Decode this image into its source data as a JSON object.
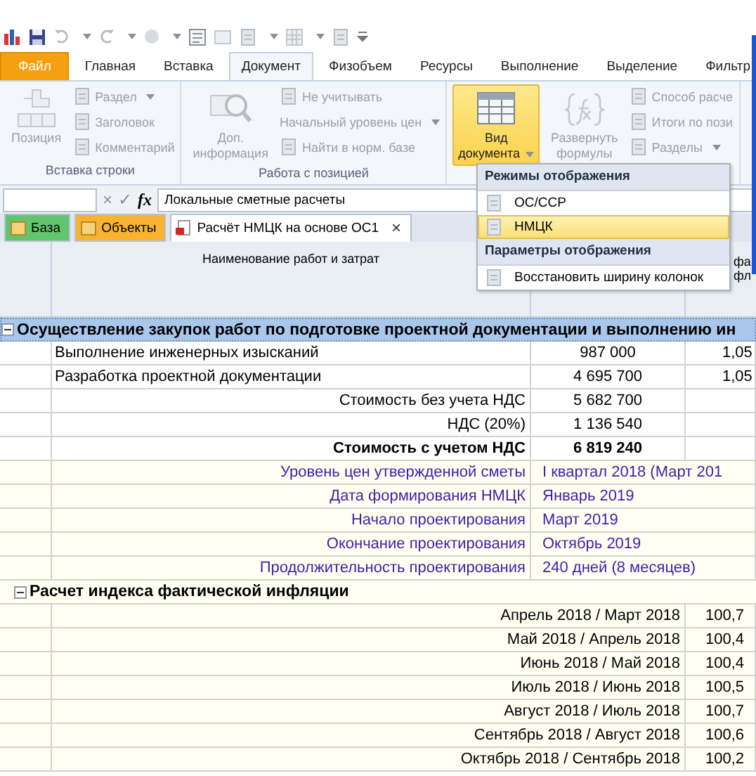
{
  "ribbon_tabs": [
    {
      "label": "Файл",
      "kind": "file",
      "selected": false
    },
    {
      "label": "Главная",
      "kind": "tab",
      "selected": false
    },
    {
      "label": "Вставка",
      "kind": "tab",
      "selected": false
    },
    {
      "label": "Документ",
      "kind": "tab",
      "selected": true
    },
    {
      "label": "Физобъем",
      "kind": "tab",
      "selected": false
    },
    {
      "label": "Ресурсы",
      "kind": "tab",
      "selected": false
    },
    {
      "label": "Выполнение",
      "kind": "tab",
      "selected": false
    },
    {
      "label": "Выделение",
      "kind": "tab",
      "selected": false
    },
    {
      "label": "Фильтр",
      "kind": "tab",
      "selected": false
    }
  ],
  "ribbon_groups": [
    {
      "label": "Вставка строки",
      "large": [
        {
          "lines": [
            "Позиция"
          ],
          "kind": "plus",
          "dropdown": false,
          "pressed": false,
          "disabled": true
        }
      ],
      "small": [
        {
          "label": "Раздел",
          "kind": "icon",
          "dropdown": true,
          "disabled": true
        },
        {
          "label": "Заголовок",
          "kind": "icon",
          "dropdown": false,
          "disabled": true
        },
        {
          "label": "Комментарий",
          "kind": "icon",
          "dropdown": false,
          "disabled": true
        }
      ]
    },
    {
      "label": "Работа с позицией",
      "large": [
        {
          "lines": [
            "Доп.",
            "информация"
          ],
          "kind": "magnifier",
          "dropdown": false,
          "pressed": false,
          "disabled": true
        }
      ],
      "small": [
        {
          "label": "Не учитывать",
          "kind": "icon",
          "dropdown": false,
          "disabled": true
        },
        {
          "label": "Начальный уровень цен",
          "kind": "plain",
          "dropdown": true,
          "disabled": true
        },
        {
          "label": "Найти в норм. базе",
          "kind": "icon",
          "dropdown": false,
          "disabled": true
        }
      ]
    },
    {
      "large": [
        {
          "lines": [
            "Вид",
            "документа"
          ],
          "kind": "table",
          "dropdown": true,
          "pressed": true,
          "disabled": false
        },
        {
          "lines": [
            "Развернуть",
            "формулы"
          ],
          "kind": "formula",
          "dropdown": false,
          "pressed": false,
          "disabled": true
        }
      ],
      "small": [
        {
          "label": "Способ расче",
          "kind": "icon",
          "dropdown": false,
          "disabled": true
        },
        {
          "label": "Итоги по пози",
          "kind": "icon",
          "dropdown": false,
          "disabled": true
        },
        {
          "label": "Разделы",
          "kind": "icon",
          "dropdown": true,
          "disabled": true
        }
      ]
    }
  ],
  "formula_bar": {
    "cancel_glyph": "×",
    "confirm_glyph": "✓",
    "function_label": "fx",
    "value": "Локальные сметные расчеты"
  },
  "doc_tabs": [
    {
      "label": "База",
      "color": "#62c46e",
      "selected": false,
      "closable": false
    },
    {
      "label": "Объекты",
      "color": "#f8b431",
      "selected": false,
      "closable": false
    },
    {
      "label": "Расчёт НМЦК на основе ОС1",
      "color": "#ffffff",
      "selected": true,
      "closable": true
    }
  ],
  "close_glyph": "×",
  "table": {
    "header_2": "Наименование работ и затрат",
    "header_4": [
      "фа",
      "фл"
    ],
    "rows": [
      {
        "kind": "section",
        "label": "Осуществление закупок работ по подготовке проектной документации и выполнению ин"
      },
      {
        "kind": "item",
        "label": "Выполнение инженерных изысканий",
        "value": "987 000",
        "column_4": "1,05"
      },
      {
        "kind": "item",
        "label": "Разработка проектной документации",
        "value": "4 695 700",
        "column_4": "1,05"
      },
      {
        "kind": "total",
        "label": "Стоимость без учета НДС",
        "value": "5 682 700",
        "bold": false
      },
      {
        "kind": "total",
        "label": "НДС (20%)",
        "value": "1 136 540",
        "bold": false
      },
      {
        "kind": "total",
        "label": "Стоимость с учетом НДС",
        "value": "6 819 240",
        "bold": true
      },
      {
        "kind": "info",
        "label": "Уровень цен утвержденной сметы",
        "value": "I квартал 2018 (Март 201"
      },
      {
        "kind": "info",
        "label": "Дата формирования НМЦК",
        "value": "Январь 2019"
      },
      {
        "kind": "info",
        "label": "Начало проектирования",
        "value": "Март 2019"
      },
      {
        "kind": "info",
        "label": "Окончание проектирования",
        "value": "Октябрь 2019"
      },
      {
        "kind": "info",
        "label": "Продолжительность проектирования",
        "value": "240 дней (8 месяцев)"
      },
      {
        "kind": "group",
        "label": "Расчет индекса фактической инфляции"
      },
      {
        "kind": "index",
        "label": "Апрель 2018 / Март 2018",
        "value": "100,7"
      },
      {
        "kind": "index",
        "label": "Май 2018 / Апрель 2018",
        "value": "100,4"
      },
      {
        "kind": "index",
        "label": "Июнь 2018 / Май 2018",
        "value": "100,4"
      },
      {
        "kind": "index",
        "label": "Июль 2018 / Июнь 2018",
        "value": "100,5"
      },
      {
        "kind": "index",
        "label": "Август 2018 / Июль 2018",
        "value": "100,7"
      },
      {
        "kind": "index",
        "label": "Сентябрь 2018 / Август 2018",
        "value": "100,6"
      },
      {
        "kind": "index",
        "label": "Октябрь 2018 / Сентябрь 2018",
        "value": "100,2"
      }
    ]
  },
  "menu": {
    "sections": [
      {
        "title": "Режимы отображения",
        "items": [
          {
            "label": "ОС/ССР",
            "selected": false
          },
          {
            "label": "НМЦК",
            "selected": true
          }
        ]
      },
      {
        "title": "Параметры отображения",
        "items": [
          {
            "label": "Восстановить ширину колонок",
            "selected": false
          }
        ]
      }
    ]
  }
}
